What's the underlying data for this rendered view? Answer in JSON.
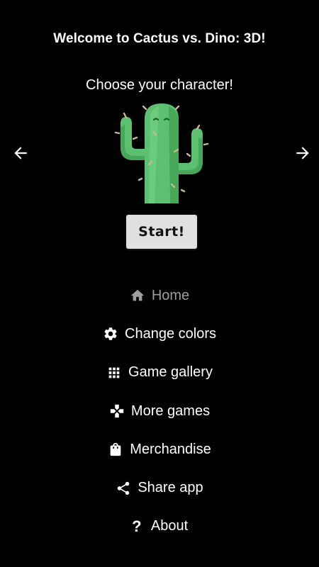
{
  "header": {
    "title": "Welcome to Cactus vs. Dino: 3D!",
    "subtitle": "Choose your character!"
  },
  "carousel": {
    "selected_character": "cactus",
    "prev_icon": "arrow-left-icon",
    "next_icon": "arrow-right-icon"
  },
  "start_button": {
    "label": "Start!"
  },
  "menu": {
    "items": [
      {
        "label": "Home",
        "icon": "home-icon",
        "current": true
      },
      {
        "label": "Change colors",
        "icon": "gear-icon",
        "current": false
      },
      {
        "label": "Game gallery",
        "icon": "grid-icon",
        "current": false
      },
      {
        "label": "More games",
        "icon": "gamepad-icon",
        "current": false
      },
      {
        "label": "Merchandise",
        "icon": "shopping-bag-icon",
        "current": false
      },
      {
        "label": "Share app",
        "icon": "share-icon",
        "current": false
      },
      {
        "label": "About",
        "icon": "help-icon",
        "current": false
      }
    ]
  },
  "colors": {
    "background": "#000000",
    "text": "#ffffff",
    "current_item": "#9e9e9e",
    "button_bg": "#e0e0e0",
    "cactus_green": "#5dc070"
  }
}
